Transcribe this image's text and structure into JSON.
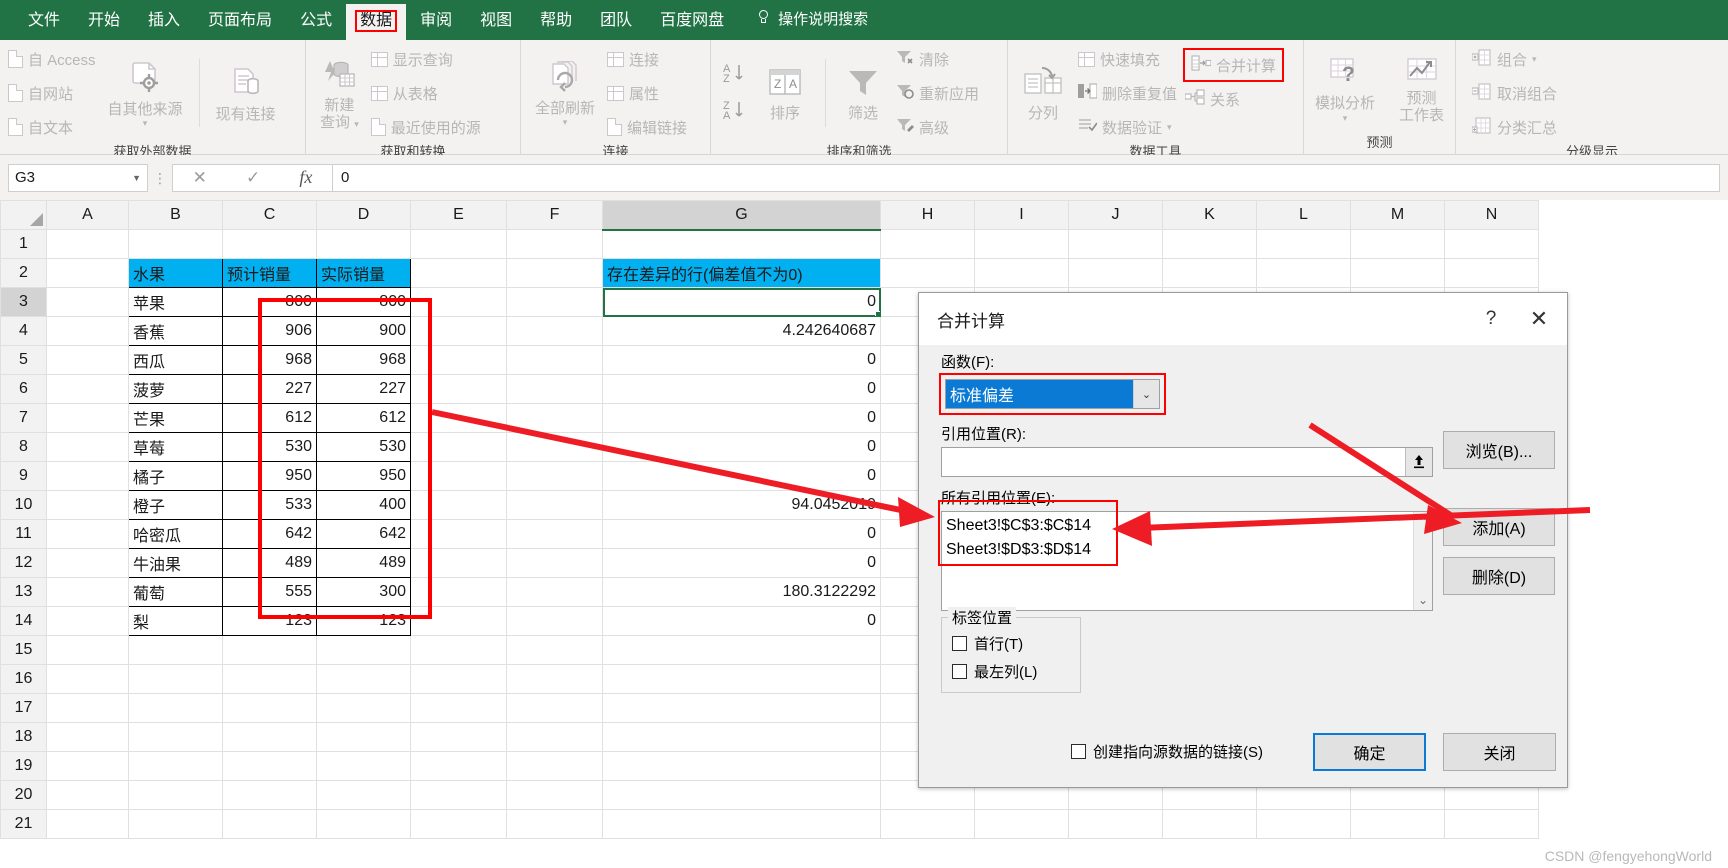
{
  "tabs": [
    {
      "label": "文件",
      "active": false
    },
    {
      "label": "开始",
      "active": false
    },
    {
      "label": "插入",
      "active": false
    },
    {
      "label": "页面布局",
      "active": false
    },
    {
      "label": "公式",
      "active": false
    },
    {
      "label": "数据",
      "active": true
    },
    {
      "label": "审阅",
      "active": false
    },
    {
      "label": "视图",
      "active": false
    },
    {
      "label": "帮助",
      "active": false
    },
    {
      "label": "团队",
      "active": false
    },
    {
      "label": "百度网盘",
      "active": false
    }
  ],
  "tellme": "操作说明搜索",
  "ribbon": {
    "groups": [
      {
        "title": "获取外部数据",
        "small_left": [
          "自 Access",
          "自网站",
          "自文本"
        ],
        "big": [
          "自其他来源"
        ],
        "big2": [
          "现有连接"
        ]
      },
      {
        "title": "获取和转换",
        "big": [
          "新建",
          "查询"
        ],
        "small": [
          "显示查询",
          "从表格",
          "最近使用的源"
        ]
      },
      {
        "title": "连接",
        "big": [
          "全部刷新"
        ],
        "small": [
          "连接",
          "属性",
          "编辑链接"
        ]
      },
      {
        "title": "排序和筛选",
        "az": "A↓",
        "az2": "Z↓",
        "sort": "排序",
        "filter": "筛选",
        "small": [
          "清除",
          "重新应用",
          "高级"
        ]
      },
      {
        "title": "数据工具",
        "big": [
          "分列"
        ],
        "small": [
          "快速填充",
          "删除重复值",
          "数据验证"
        ],
        "small2": [
          "合并计算",
          "关系"
        ]
      },
      {
        "title": "预测",
        "big": [
          "模拟分析"
        ],
        "big2": [
          "预测",
          "工作表"
        ]
      },
      {
        "title": "分级显示",
        "small": [
          "组合",
          "取消组合",
          "分类汇总"
        ]
      }
    ]
  },
  "formula_bar": {
    "name_box": "G3",
    "cancel_icon": "✕",
    "confirm_icon": "✓",
    "fx_icon": "fx",
    "value": "0"
  },
  "grid": {
    "columns": [
      "A",
      "B",
      "C",
      "D",
      "E",
      "F",
      "G",
      "H",
      "I",
      "J",
      "K",
      "L",
      "M",
      "N"
    ],
    "selected_column": "G",
    "rows": [
      1,
      2,
      3,
      4,
      5,
      6,
      7,
      8,
      9,
      10,
      11,
      12,
      13,
      14,
      15,
      16,
      17,
      18,
      19,
      20,
      21
    ],
    "selected_row": 3,
    "headers": {
      "B": "水果",
      "C": "预计销量",
      "D": "实际销量",
      "G": "存在差异的行(偏差值不为0)"
    },
    "data": [
      {
        "row": 3,
        "B": "苹果",
        "C": "800",
        "D": "800",
        "G": ""
      },
      {
        "row": 4,
        "B": "香蕉",
        "C": "906",
        "D": "900",
        "G": "4.242640687"
      },
      {
        "row": 5,
        "B": "西瓜",
        "C": "968",
        "D": "968",
        "G": "0"
      },
      {
        "row": 6,
        "B": "菠萝",
        "C": "227",
        "D": "227",
        "G": "0"
      },
      {
        "row": 7,
        "B": "芒果",
        "C": "612",
        "D": "612",
        "G": "0"
      },
      {
        "row": 8,
        "B": "草莓",
        "C": "530",
        "D": "530",
        "G": "0"
      },
      {
        "row": 9,
        "B": "橘子",
        "C": "950",
        "D": "950",
        "G": "0"
      },
      {
        "row": 10,
        "B": "橙子",
        "C": "533",
        "D": "400",
        "G": "94.0452019"
      },
      {
        "row": 11,
        "B": "哈密瓜",
        "C": "642",
        "D": "642",
        "G": "0"
      },
      {
        "row": 12,
        "B": "牛油果",
        "C": "489",
        "D": "489",
        "G": "0"
      },
      {
        "row": 13,
        "B": "葡萄",
        "C": "555",
        "D": "300",
        "G": "180.3122292"
      },
      {
        "row": 14,
        "B": "梨",
        "C": "123",
        "D": "123",
        "G": "0"
      }
    ],
    "selected_cell_value": "0"
  },
  "dialog": {
    "title": "合并计算",
    "help_icon": "?",
    "close_icon": "✕",
    "function_label": "函数(F):",
    "function_value": "标准偏差",
    "reference_label": "引用位置(R):",
    "reference_value": "",
    "all_references_label": "所有引用位置(E):",
    "all_references": [
      "Sheet3!$C$3:$C$14",
      "Sheet3!$D$3:$D$14"
    ],
    "label_position_legend": "标签位置",
    "checkbox_top_row": "首行(T)",
    "checkbox_left_col": "最左列(L)",
    "checkbox_create_link": "创建指向源数据的链接(S)",
    "browse_button": "浏览(B)...",
    "add_button": "添加(A)",
    "delete_button": "删除(D)",
    "ok_button": "确定",
    "close_button": "关闭"
  },
  "watermark": "CSDN @fengyehongWorld",
  "colors": {
    "ribbon_green": "#217346",
    "header_cyan": "#00b0f0",
    "annotation_red": "#ff0000",
    "select_blue": "#0b7ad4"
  }
}
